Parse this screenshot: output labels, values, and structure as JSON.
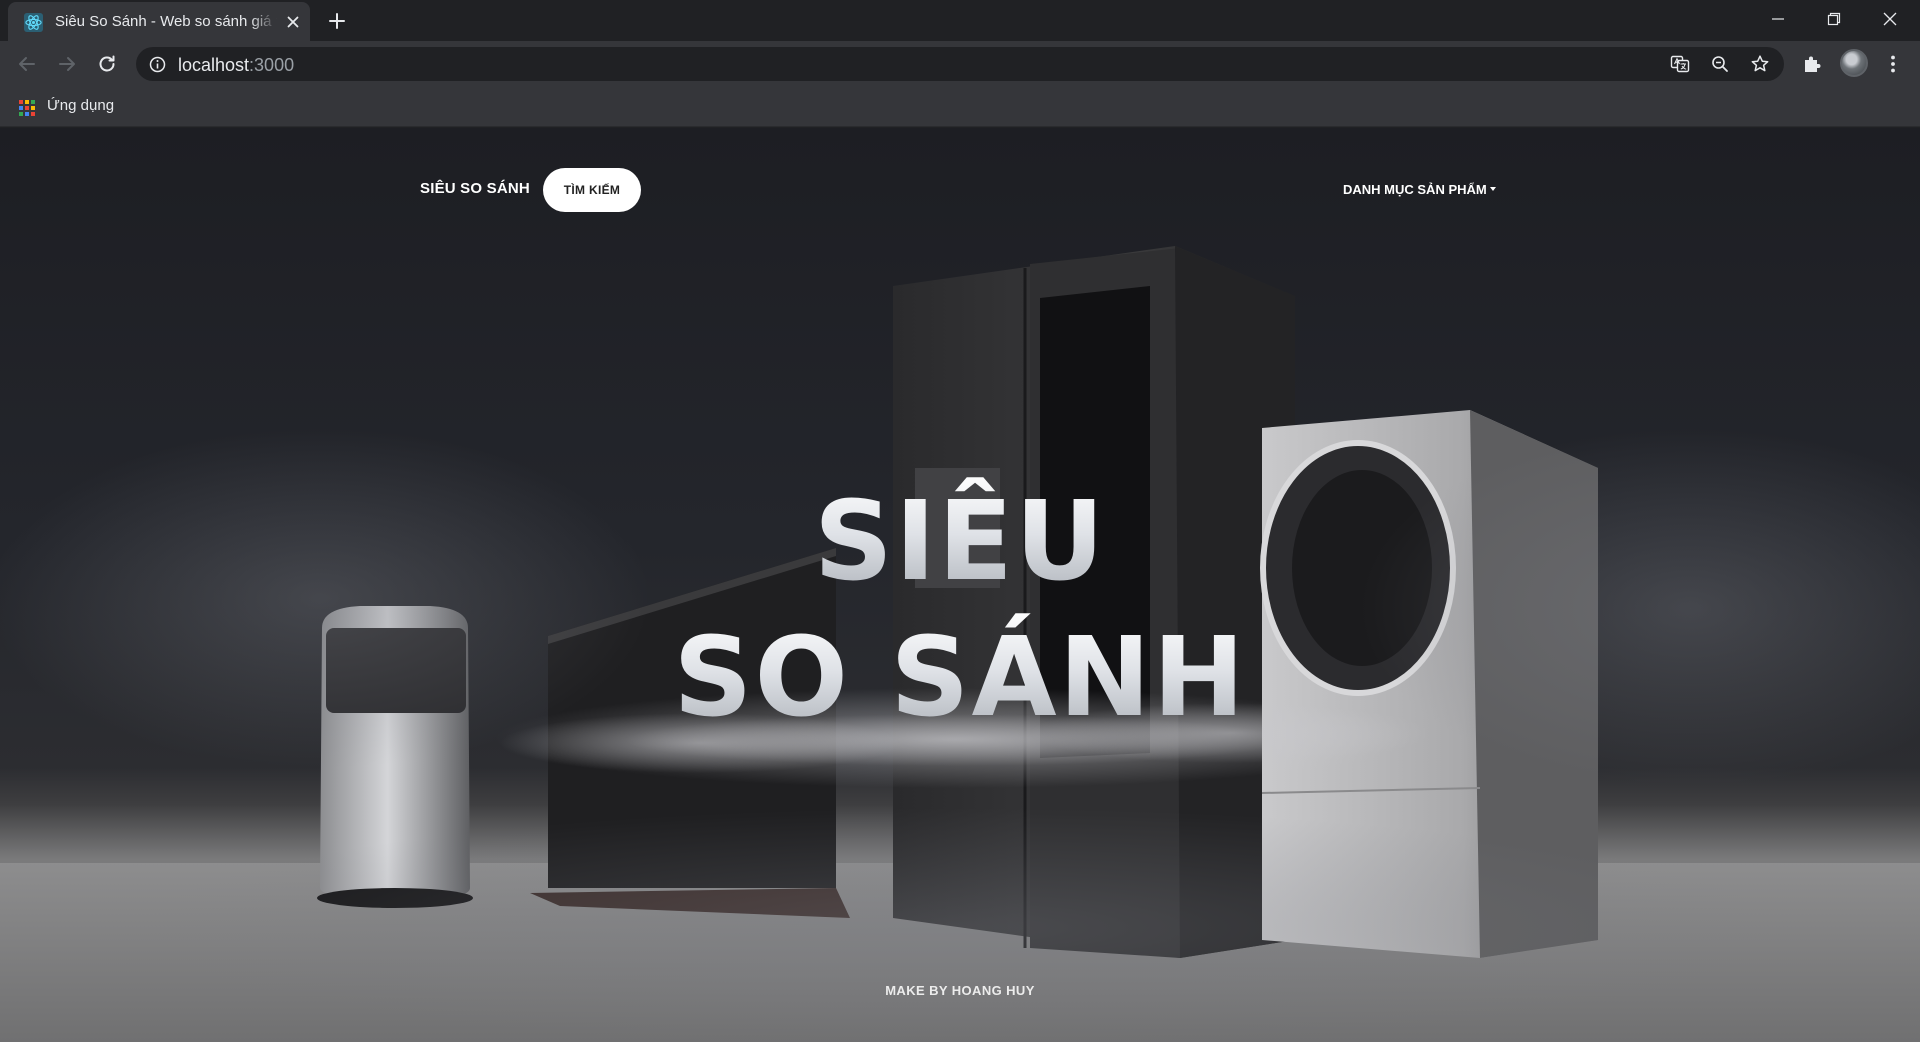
{
  "browser": {
    "tab": {
      "title": "Siêu So Sánh - Web so sánh giá tốt nhất"
    },
    "address": {
      "host": "localhost",
      "port": ":3000"
    },
    "bookmarks": {
      "apps_label": "Ứng dụng"
    }
  },
  "page": {
    "nav": {
      "brand": "SIÊU SO SÁNH",
      "search_button": "TÌM KIẾM",
      "category_menu": "DANH MỤC SẢN PHẨM"
    },
    "hero": {
      "line1": "SIÊU",
      "line2": "SO SÁNH"
    },
    "footer": {
      "credit": "MAKE BY HOANG HUY"
    }
  },
  "colors": {
    "chrome_dark": "#202124",
    "chrome_toolbar": "#35363a",
    "accent_react": "#61dafb",
    "hero_text": "#e8eaee"
  }
}
